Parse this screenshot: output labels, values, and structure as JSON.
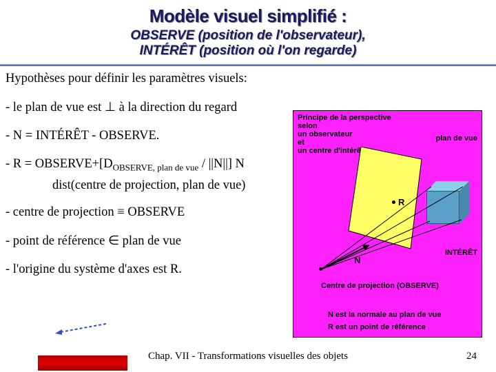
{
  "title": "Modèle visuel simplifié :",
  "subtitle_line1": "OBSERVE (position de l'observateur),",
  "subtitle_line2": "INTÉRÊT (position où l'on regarde)",
  "hypotheses_heading": "Hypothèses pour définir les paramètres visuels:",
  "items": [
    "- le plan de vue est ⊥ à la direction du regard",
    "- N = INTÉRÊT - OBSERVE.",
    "",
    "- centre de projection ≡ OBSERVE",
    "- point de référence ∈ plan de vue",
    "- l'origine du système d'axes est R."
  ],
  "item_r_prefix": "- R = OBSERVE+[D",
  "item_r_sub": "OBSERVE, plan de vue",
  "item_r_suffix": " / ||N||] N",
  "indent_line": "dist(centre de projection, plan de vue)",
  "diagram": {
    "principle_l1": "Principe de la perspective",
    "principle_l2": "selon",
    "principle_l3": "un observateur",
    "principle_l4": "et",
    "principle_l5": "un centre d'intérêt",
    "plan_de_vue": "plan de vue",
    "n_label": "N",
    "r_label": "R",
    "interet": "INTÉRÊT",
    "centre_proj": "Centre de projection (OBSERVE)",
    "note1": "N est la normale au plan de vue",
    "note2": "R est un point de référence"
  },
  "footer": "Chap. VII - Transformations visuelles des objets",
  "page_number": "24"
}
